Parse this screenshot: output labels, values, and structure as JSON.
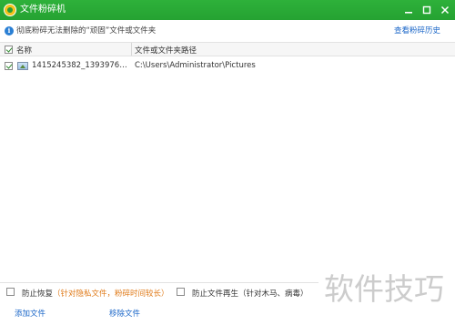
{
  "window": {
    "title": "文件粉碎机",
    "controls": [
      "minimize-icon",
      "maximize-icon",
      "close-icon"
    ]
  },
  "infobar": {
    "icon": "info-icon",
    "text": "彻底粉碎无法删除的“顽固”文件或文件夹",
    "history_link": "查看粉碎历史"
  },
  "table": {
    "columns": [
      "名称",
      "文件或文件夹路径"
    ],
    "header_checked": true,
    "rows": [
      {
        "checked": true,
        "icon": "image-file-icon",
        "name": "1415245382_1393976250...",
        "path": "C:\\Users\\Administrator\\Pictures"
      }
    ]
  },
  "options": {
    "prevent_recovery": {
      "label": "防止恢复",
      "note": "（针对隐私文件，粉碎时间较长）",
      "checked": false
    },
    "prevent_regeneration": {
      "label": "防止文件再生（针对木马、病毒）",
      "checked": false
    }
  },
  "actions": {
    "add": "添加文件",
    "remove": "移除文件"
  },
  "watermark": "软件技巧",
  "colors": {
    "titlebar": "#25a232",
    "link": "#1a66c8",
    "note": "#e07b1a"
  }
}
